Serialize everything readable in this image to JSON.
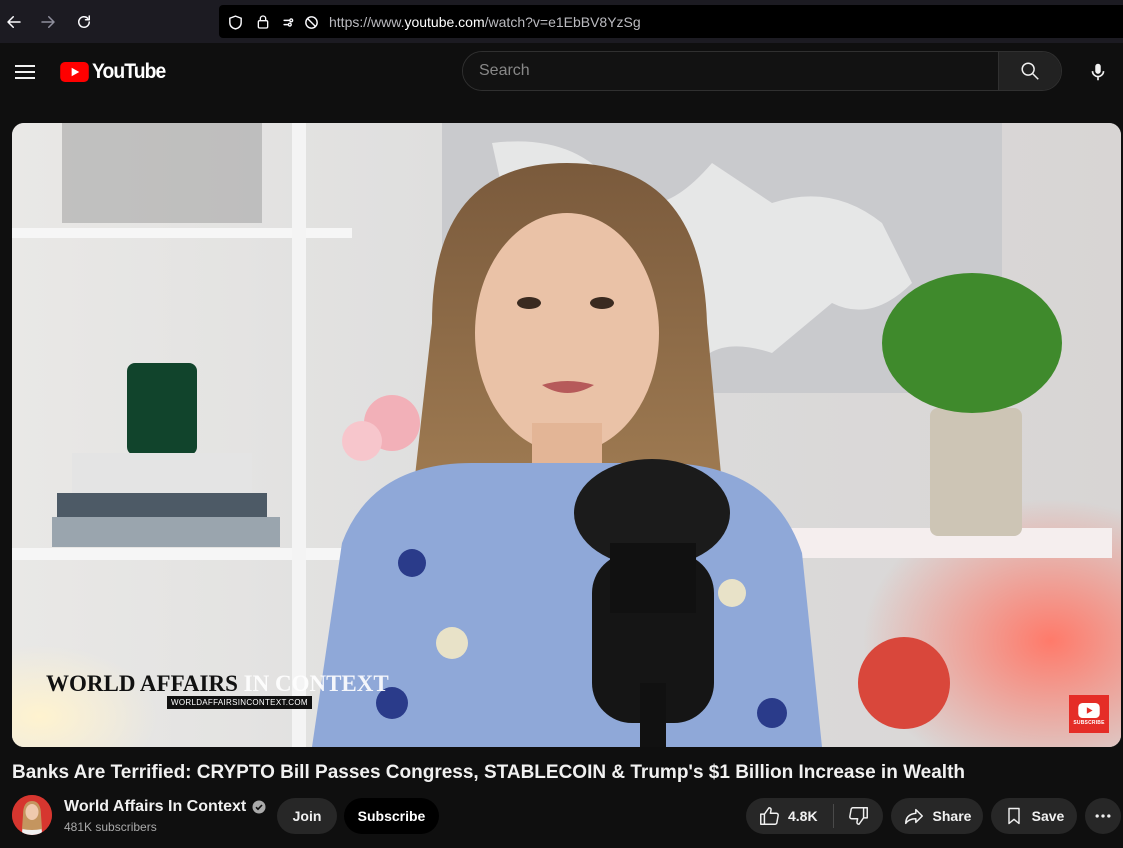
{
  "browser": {
    "url_prefix": "https://www.",
    "url_host": "youtube.com",
    "url_path": "/watch?v=e1EbBV8YzSg"
  },
  "header": {
    "logo_text": "YouTube",
    "search_placeholder": "Search",
    "icons": [
      "menu-icon",
      "youtube-logo-icon",
      "search-icon",
      "microphone-icon"
    ]
  },
  "video": {
    "watermark_title_main": "WORLD AFFAIRS",
    "watermark_title_tail": " IN CONTEXT",
    "watermark_url": "WORLDAFFAIRSINCONTEXT.COM",
    "subscribe_badge_text": "SUBSCRIBE"
  },
  "meta": {
    "title": "Banks Are Terrified: CRYPTO Bill Passes Congress, STABLECOIN & Trump's $1 Billion Increase in Wealth",
    "channel_name": "World Affairs In Context",
    "subscribers": "481K subscribers",
    "join_label": "Join",
    "subscribe_label": "Subscribe",
    "like_count": "4.8K",
    "share_label": "Share",
    "save_label": "Save"
  },
  "colors": {
    "background": "#0f0f0f",
    "brand_red": "#ff0000",
    "pill_bg": "#272727",
    "text_primary": "#f1f1f1",
    "text_secondary": "#aaaaaa"
  }
}
